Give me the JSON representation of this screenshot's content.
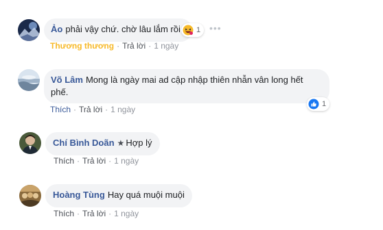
{
  "comments": [
    {
      "author": "Ảo",
      "text": "phải vậy chứ. chờ lâu lắm rồi",
      "reaction_count": "1",
      "reaction_icon": "haha-emoji-icon",
      "actions": {
        "tag": "Thương thương",
        "reply": "Trả lời",
        "time": "1 ngày"
      }
    },
    {
      "author": "Võ Lâm",
      "text_line1": "Mong là ngày mai ad cập nhập thiên nhẫn vân long hết",
      "text_line2": "phế.",
      "reaction_count": "1",
      "reaction_icon": "like-thumb-icon",
      "actions": {
        "like": "Thích",
        "reply": "Trả lời",
        "time": "1 ngày"
      }
    },
    {
      "author": "Chí Bình Doãn",
      "text": "Hợp lý",
      "actions": {
        "like": "Thích",
        "reply": "Trả lời",
        "time": "1 ngày"
      }
    },
    {
      "author": "Hoàng Tùng",
      "text": "Hay quá muội muội",
      "actions": {
        "like": "Thích",
        "reply": "Trả lời",
        "time": "1 ngày"
      }
    }
  ],
  "colors": {
    "author": "#385898",
    "bubble": "#f2f3f5",
    "tag": "#f7b928",
    "like_blue": "#1877f2"
  }
}
